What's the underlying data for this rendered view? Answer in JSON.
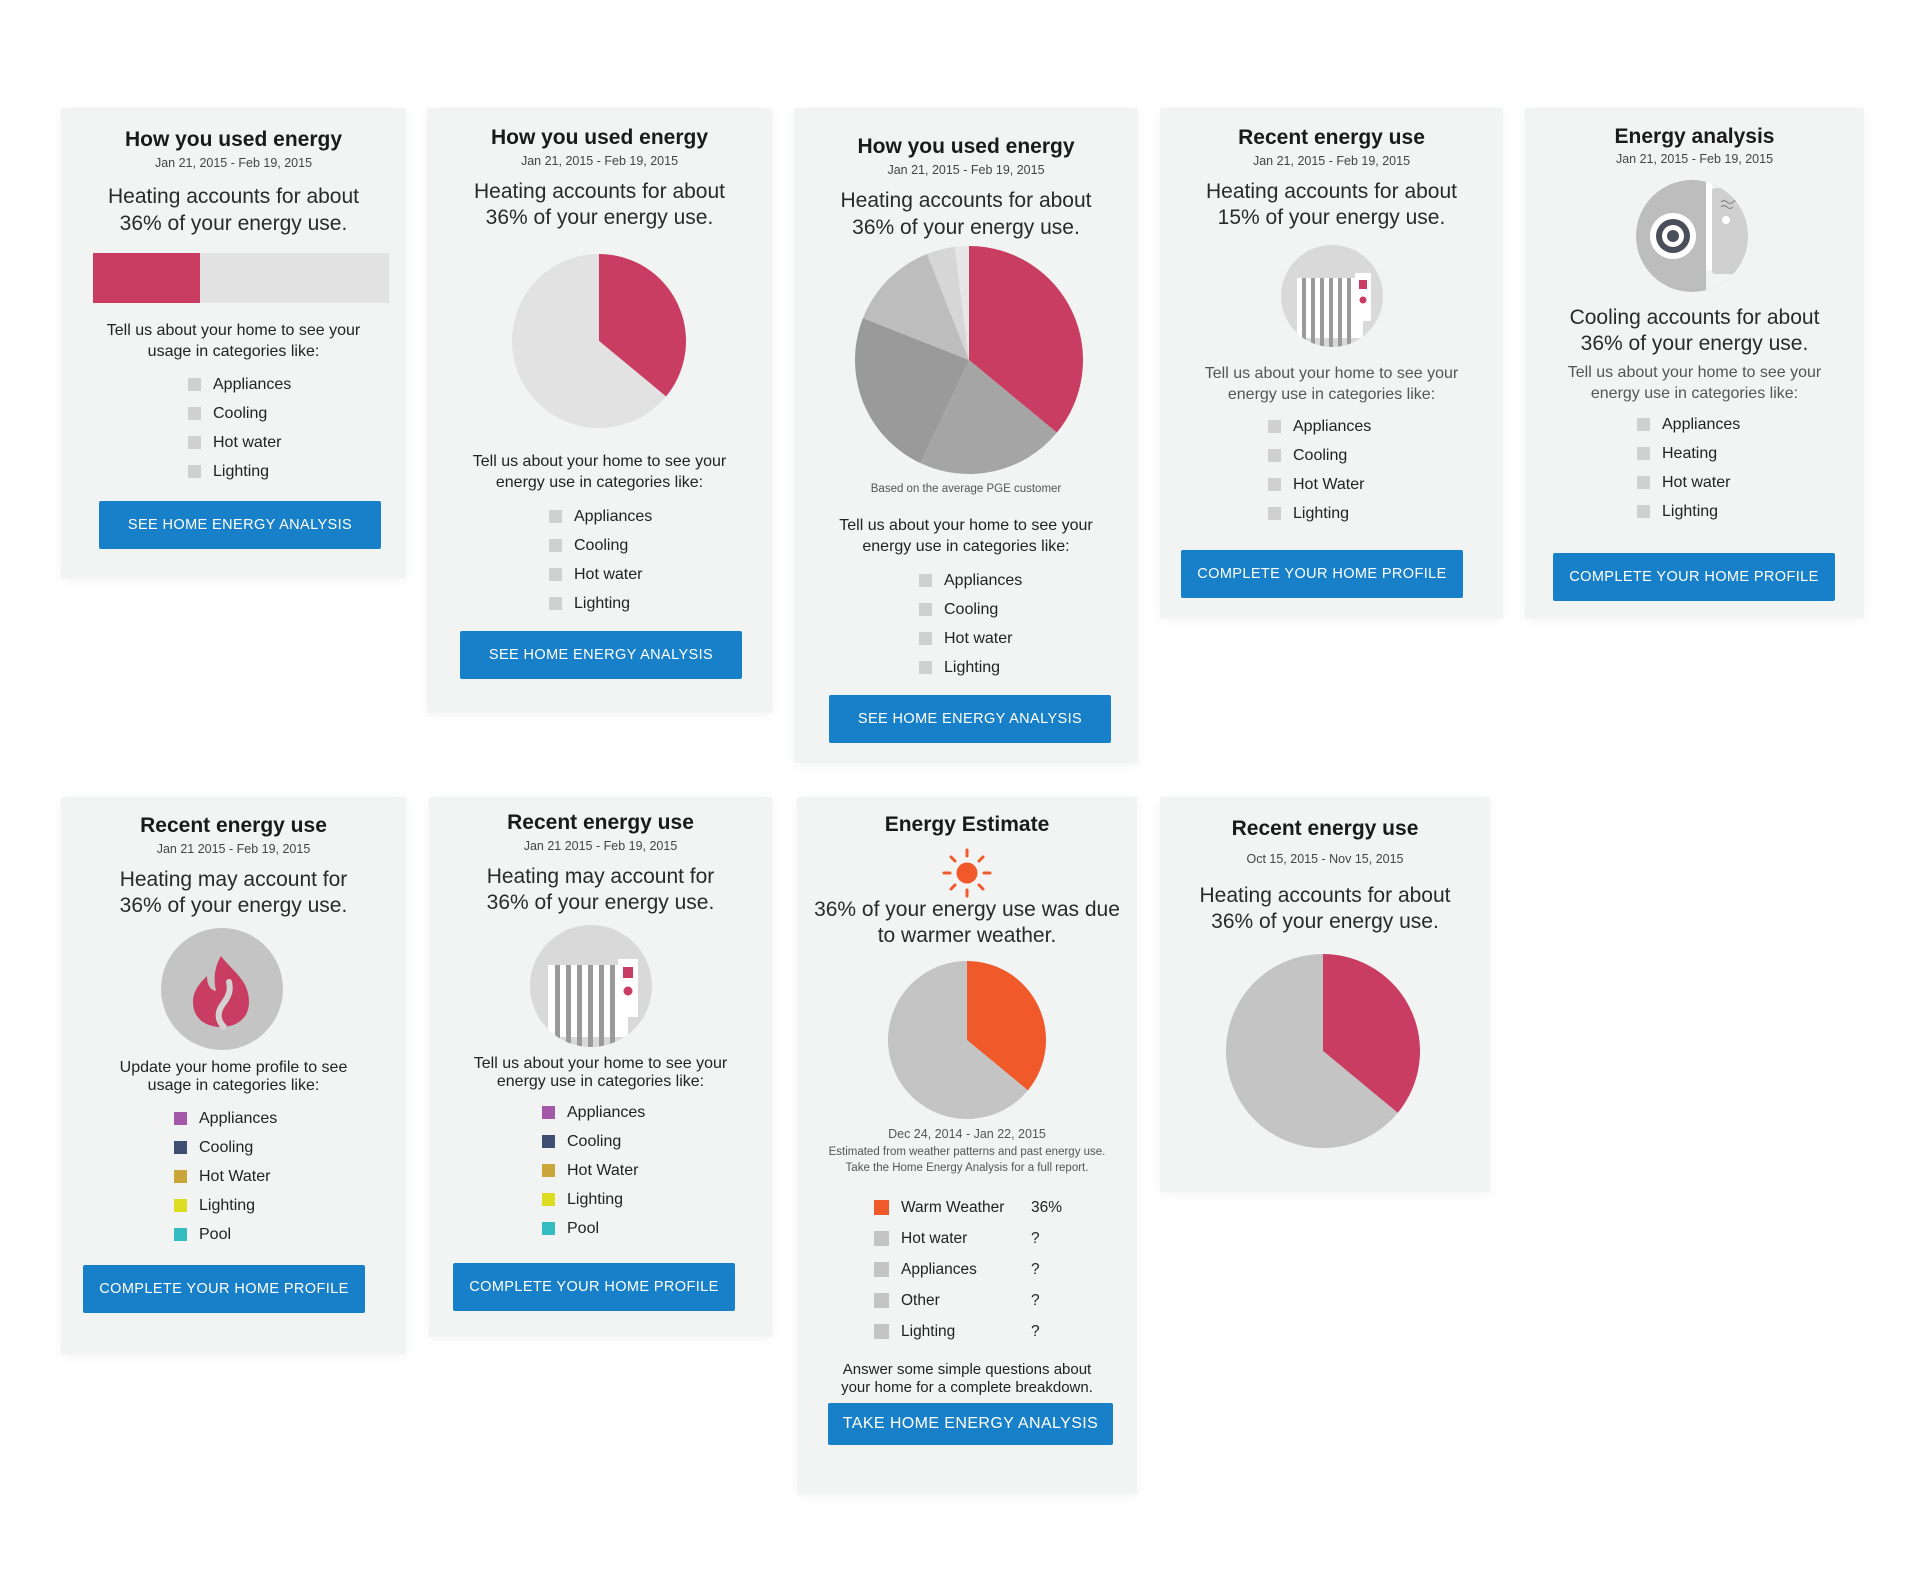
{
  "cards": [
    {
      "title": "How you used energy",
      "date": "Jan 21, 2015  - Feb 19, 2015",
      "headline_1": "Heating accounts for about",
      "headline_2": "36% of your energy use.",
      "bar_fraction": 0.36,
      "prompt_1": "Tell us about your home to see your",
      "prompt_2": "usage in categories like:",
      "categories": [
        "Appliances",
        "Cooling",
        "Hot water",
        "Lighting"
      ],
      "button": "SEE HOME ENERGY ANALYSIS"
    },
    {
      "title": "How you used energy",
      "date": "Jan 21, 2015  - Feb 19, 2015",
      "headline_1": "Heating accounts for about",
      "headline_2": "36% of your energy use.",
      "pie_heating_percent": 36,
      "prompt_1": "Tell us about your home to see your",
      "prompt_2": "energy use in categories like:",
      "categories": [
        "Appliances",
        "Cooling",
        "Hot water",
        "Lighting"
      ],
      "button": "SEE HOME ENERGY ANALYSIS"
    },
    {
      "title": "How you used energy",
      "date": "Jan 21, 2015  - Feb 19, 2015",
      "headline_1": "Heating accounts for about",
      "headline_2": "36% of your energy use.",
      "pie_slices_percent": [
        36,
        21,
        24,
        13,
        4,
        2
      ],
      "pie_note": "Based on the average PGE customer",
      "prompt_1": "Tell us about your home to see your",
      "prompt_2": "energy use in categories like:",
      "categories": [
        "Appliances",
        "Cooling",
        "Hot water",
        "Lighting"
      ],
      "button": "SEE HOME ENERGY ANALYSIS"
    },
    {
      "title": "Recent energy use",
      "date": "Jan 21, 2015  - Feb 19, 2015",
      "headline_1": "Heating accounts for about",
      "headline_2": "15% of your energy use.",
      "icon": "radiator-icon",
      "prompt_1": "Tell us about your home to see your",
      "prompt_2": "energy use in categories like:",
      "categories": [
        "Appliances",
        "Cooling",
        "Hot Water",
        "Lighting"
      ],
      "button": "COMPLETE YOUR HOME PROFILE"
    },
    {
      "title": "Energy analysis",
      "date": "Jan 21, 2015  - Feb 19, 2015",
      "icon": "air-conditioner-icon",
      "headline_1": "Cooling accounts for about",
      "headline_2": "36% of your energy use.",
      "prompt_1": "Tell us about your home to see your",
      "prompt_2": "energy use in categories like:",
      "categories": [
        "Appliances",
        "Heating",
        "Hot water",
        "Lighting"
      ],
      "button": "COMPLETE YOUR HOME PROFILE"
    },
    {
      "title": "Recent energy use",
      "date": "Jan 21 2015  - Feb 19, 2015",
      "headline_1": "Heating may account for",
      "headline_2": "36% of your energy use.",
      "icon": "flame-icon",
      "prompt_1": "Update your home profile to see",
      "prompt_2": "usage in categories like:",
      "categories": [
        "Appliances",
        "Cooling",
        "Hot Water",
        "Lighting",
        "Pool"
      ],
      "category_colors": [
        "#a359a8",
        "#3f4e73",
        "#c9a53a",
        "#dcdc22",
        "#35bcc0"
      ],
      "button": "COMPLETE YOUR HOME PROFILE"
    },
    {
      "title": "Recent energy use",
      "date": "Jan 21 2015  - Feb 19, 2015",
      "headline_1": "Heating may account for",
      "headline_2": "36% of your energy use.",
      "icon": "radiator-icon",
      "prompt_1": "Tell us about your home to see your",
      "prompt_2": "energy use in categories like:",
      "categories": [
        "Appliances",
        "Cooling",
        "Hot Water",
        "Lighting",
        "Pool"
      ],
      "category_colors": [
        "#a359a8",
        "#3f4e73",
        "#c9a53a",
        "#dcdc22",
        "#35bcc0"
      ],
      "button": "COMPLETE YOUR HOME PROFILE"
    },
    {
      "title": "Energy Estimate",
      "icon": "sun-icon",
      "headline_1": "36% of your energy use was due",
      "headline_2": "to warmer weather.",
      "pie_warm_percent": 36,
      "date": "Dec 24, 2014 - Jan 22, 2015",
      "note_1": "Estimated from weather patterns and past energy use.",
      "note_2": "Take the Home Energy Analysis for a full report.",
      "rows": [
        {
          "label": "Warm Weather",
          "value": "36%",
          "color": "#f05a2a"
        },
        {
          "label": "Hot water",
          "value": "?",
          "color": "#c4c4c4"
        },
        {
          "label": "Appliances",
          "value": "?",
          "color": "#c4c4c4"
        },
        {
          "label": "Other",
          "value": "?",
          "color": "#c4c4c4"
        },
        {
          "label": "Lighting",
          "value": "?",
          "color": "#c4c4c4"
        }
      ],
      "footer_1": "Answer some simple questions about",
      "footer_2": "your home for a complete breakdown.",
      "button": "TAKE HOME ENERGY ANALYSIS"
    },
    {
      "title": "Recent energy use",
      "date": "Oct 15, 2015 - Nov 15, 2015",
      "headline_1": "Heating accounts for about",
      "headline_2": "36% of your energy use.",
      "pie_heating_percent": 36
    }
  ],
  "colors": {
    "heating": "#c93d62",
    "warm": "#f05a2a",
    "button": "#1880c8",
    "empty": "#e2e2e2",
    "pie_grey": "#c4c4c4"
  }
}
